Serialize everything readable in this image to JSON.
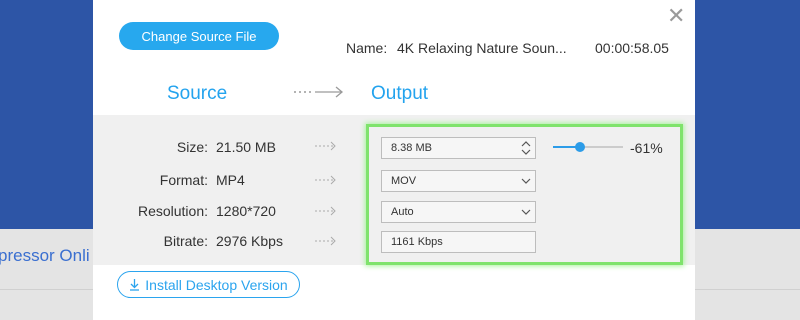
{
  "background": {
    "partial_text": "pressor Onli"
  },
  "header": {
    "change_source_label": "Change Source File",
    "name_label": "Name:",
    "file_name": "4K Relaxing Nature Soun...",
    "duration": "00:00:58.05"
  },
  "columns": {
    "source": "Source",
    "output": "Output"
  },
  "rows": [
    {
      "label": "Size:",
      "source_value": "21.50 MB"
    },
    {
      "label": "Format:",
      "source_value": "MP4"
    },
    {
      "label": "Resolution:",
      "source_value": "1280*720"
    },
    {
      "label": "Bitrate:",
      "source_value": "2976 Kbps"
    }
  ],
  "output": {
    "size_value": "8.38  MB",
    "format_value": "MOV",
    "resolution_value": "Auto",
    "bitrate_value": "1161 Kbps",
    "compression_percent": "-61%",
    "slider_fraction": 0.39
  },
  "footer": {
    "install_label": "Install Desktop Version"
  },
  "colors": {
    "accent": "#27a8ee",
    "highlight_border": "#7fe36c",
    "page_background": "#2d55a6"
  },
  "icons": {
    "close": "close-icon",
    "arrow": "arrow-right-icon",
    "stepper": "up-down-chevron-icon",
    "dropdown": "chevron-down-icon",
    "download": "download-icon"
  }
}
